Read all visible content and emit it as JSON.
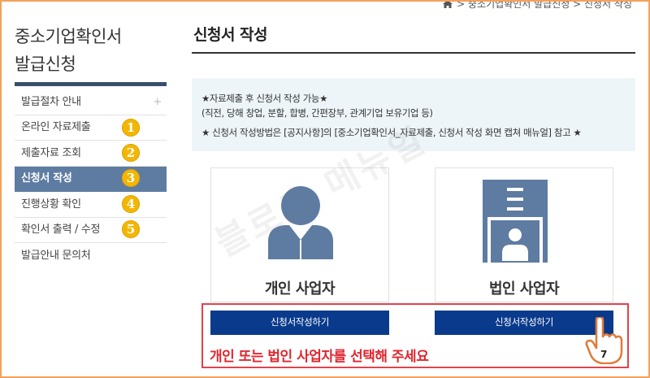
{
  "breadcrumb": {
    "text": "> 중소기업확인서 발급신청 > 신청서 작성"
  },
  "sidebar": {
    "title_line1": "중소기업확인서",
    "title_line2": "발급신청",
    "items": [
      {
        "label": "발급절차 안내",
        "expand": "+"
      },
      {
        "label": "온라인 자료제출",
        "badge": "1"
      },
      {
        "label": "제출자료 조회",
        "badge": "2"
      },
      {
        "label": "신청서 작성",
        "badge": "3",
        "active": true
      },
      {
        "label": "진행상황 확인",
        "badge": "4"
      },
      {
        "label": "확인서 출력 / 수정",
        "badge": "5"
      },
      {
        "label": "발급안내 문의처"
      }
    ]
  },
  "main": {
    "title": "신청서 작성",
    "notice": {
      "line1": "★자료제출 후 신청서 작성 가능★",
      "line2": "(직전, 당해 창업, 분할, 합병, 간편장부, 관계기업 보유기업 등)",
      "line3": "★ 신청서 작성방법은 [공지사항]의 [중소기업확인서_자료제출, 신청서 작성 화면 캡쳐 매뉴얼] 참고 ★"
    },
    "cards": [
      {
        "label": "개인 사업자",
        "icon": "person-icon",
        "button": "신청서작성하기"
      },
      {
        "label": "법인 사업자",
        "icon": "building-icon",
        "button": "신청서작성하기"
      }
    ]
  },
  "annotation": {
    "message": "개인 또는 법인 사업자를 선택해 주세요",
    "step": "7",
    "watermark": "블로그 메뉴얼"
  },
  "colors": {
    "navy_button": "#0a3a8c",
    "active_menu": "#5e7ca2",
    "sidebar_bar": "#3a4f6b",
    "badge": "#f2b705",
    "icon_blue": "#5e7ca2",
    "callout_red": "#e0434a",
    "notice_bg": "#eef5f9"
  }
}
